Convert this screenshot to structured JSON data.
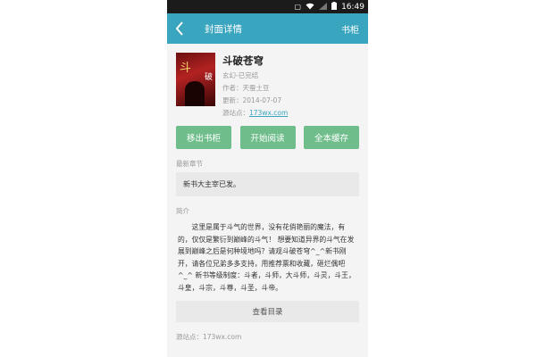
{
  "status": {
    "time": "16:49"
  },
  "appbar": {
    "title": "封面详情",
    "right_link": "书柜"
  },
  "book": {
    "cover_text_main": "斗",
    "cover_text_side": "破",
    "name": "斗破苍穹",
    "category": "玄幻-已完结",
    "author": "作者：天蚕土豆",
    "updated": "更新：2014-07-07",
    "source_label": "源站点：",
    "source_link": "173wx.com"
  },
  "buttons": {
    "remove": "移出书柜",
    "read": "开始阅读",
    "cache": "全本缓存"
  },
  "latest": {
    "label": "最新章节",
    "chapter": "新书大主宰已发。"
  },
  "intro": {
    "label": "简介",
    "text": "这里是属于斗气的世界，没有花俏艳丽的魔法，有的，仅仅是繁衍到巅峰的斗气！ 想要知道异界的斗气在发展到巅峰之后是何种境地吗？请观斗破苍穹^_^新书刚开，请各位兄弟多多支持，用推荐票和收藏，砸烂偶吧^_^ 新书等级制度：斗者，斗师，大斗师，斗灵，斗王，斗皇，斗宗，斗尊，斗圣，斗帝。"
  },
  "toc_button": "查看目录",
  "footer_source": "源站点：173wx.com",
  "colors": {
    "appbar": "#3aa5bf",
    "button": "#6fbd8b"
  }
}
